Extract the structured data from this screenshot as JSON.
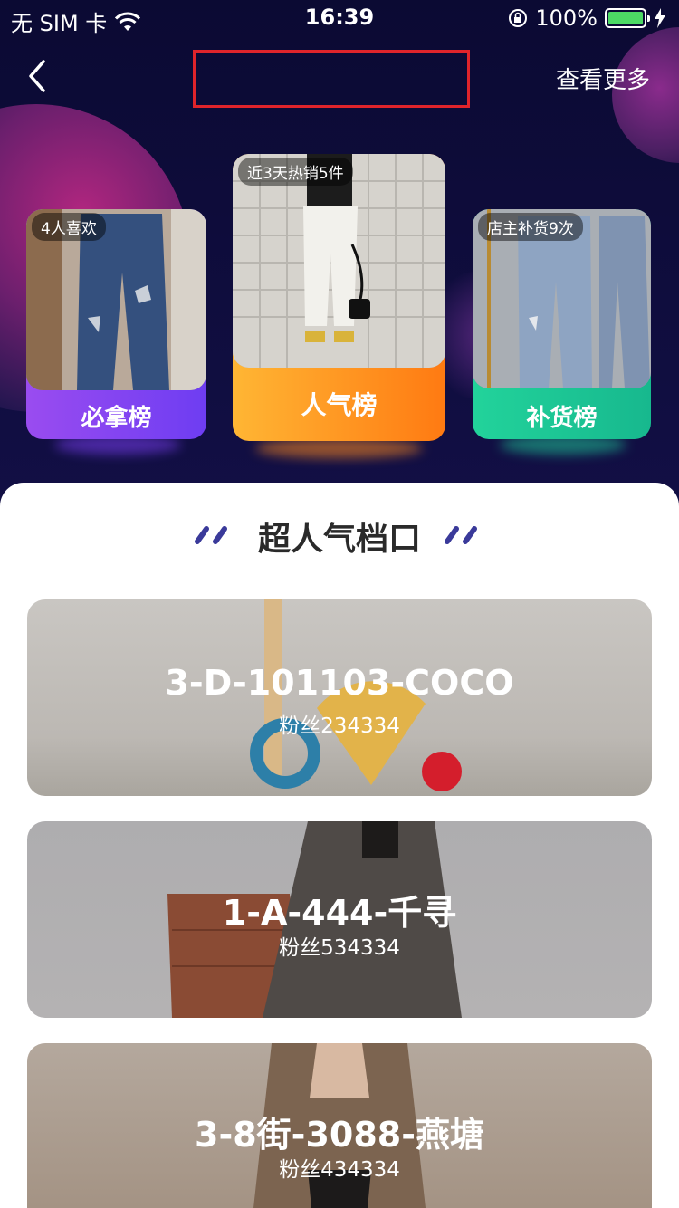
{
  "status_bar": {
    "carrier": "无 SIM 卡",
    "time": "16:39",
    "battery": "100%"
  },
  "nav": {
    "more_label": "查看更多"
  },
  "rankings": [
    {
      "badge": "4人喜欢",
      "label": "必拿榜"
    },
    {
      "badge": "近3天热销5件",
      "label": "人气榜"
    },
    {
      "badge": "店主补货9次",
      "label": "补货榜"
    }
  ],
  "section": {
    "title": "超人气档口"
  },
  "shops": [
    {
      "name": "3-D-101103-COCO",
      "fans": "粉丝234334"
    },
    {
      "name": "1-A-444-千寻",
      "fans": "粉丝534334"
    },
    {
      "name": "3-8街-3088-燕塘",
      "fans": "粉丝434334"
    }
  ],
  "colors": {
    "hero_bg": "#0e0b3a",
    "purple": "#7a3df2",
    "orange": "#ff8a1f",
    "green": "#1fc796",
    "nav_title_border": "#e0242b"
  }
}
